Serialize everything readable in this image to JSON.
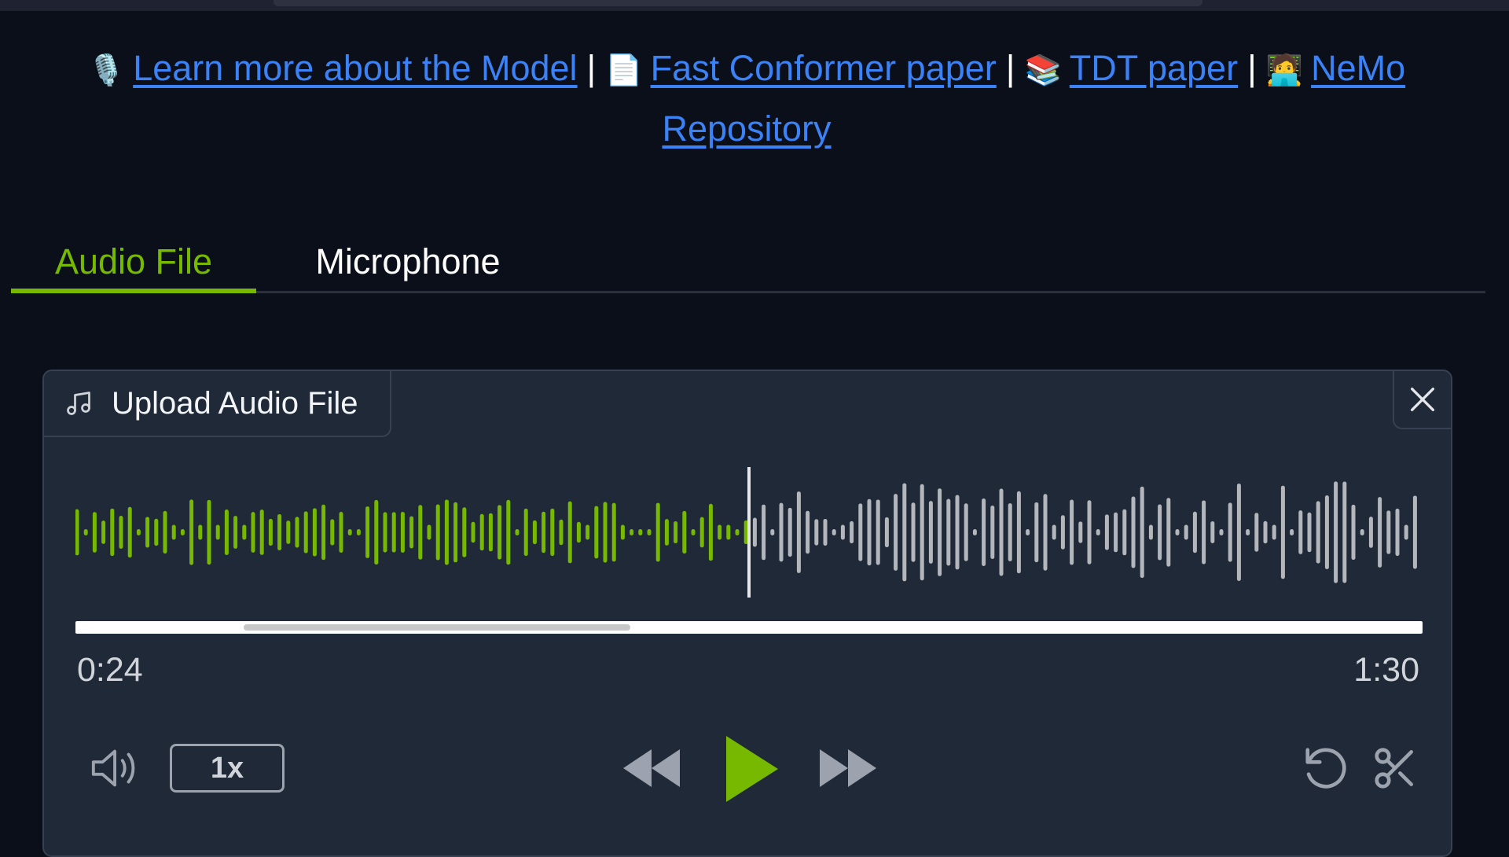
{
  "links": {
    "model": {
      "emoji": "🎙️",
      "label": "Learn more about the Model"
    },
    "fast_conformer": {
      "emoji": "📄",
      "label": "Fast Conformer paper"
    },
    "tdt": {
      "emoji": "📚",
      "label": "TDT paper"
    },
    "nemo": {
      "emoji": "🧑‍💻",
      "label": "NeMo Repository"
    },
    "separator": "|"
  },
  "tabs": [
    {
      "label": "Audio File",
      "active": true
    },
    {
      "label": "Microphone",
      "active": false
    }
  ],
  "audio": {
    "upload_label": "Upload Audio File",
    "current_time": "0:24",
    "duration": "1:30",
    "speed": "1x",
    "played_fraction": 0.5,
    "played_color": "#76b900",
    "unplayed_color": "#b3b6bb"
  },
  "icons": {
    "upload": "music-note-icon",
    "close": "close-icon",
    "volume": "volume-icon",
    "rewind": "rewind-icon",
    "play": "play-icon",
    "forward": "fast-forward-icon",
    "reset": "undo-icon",
    "trim": "scissors-icon"
  }
}
